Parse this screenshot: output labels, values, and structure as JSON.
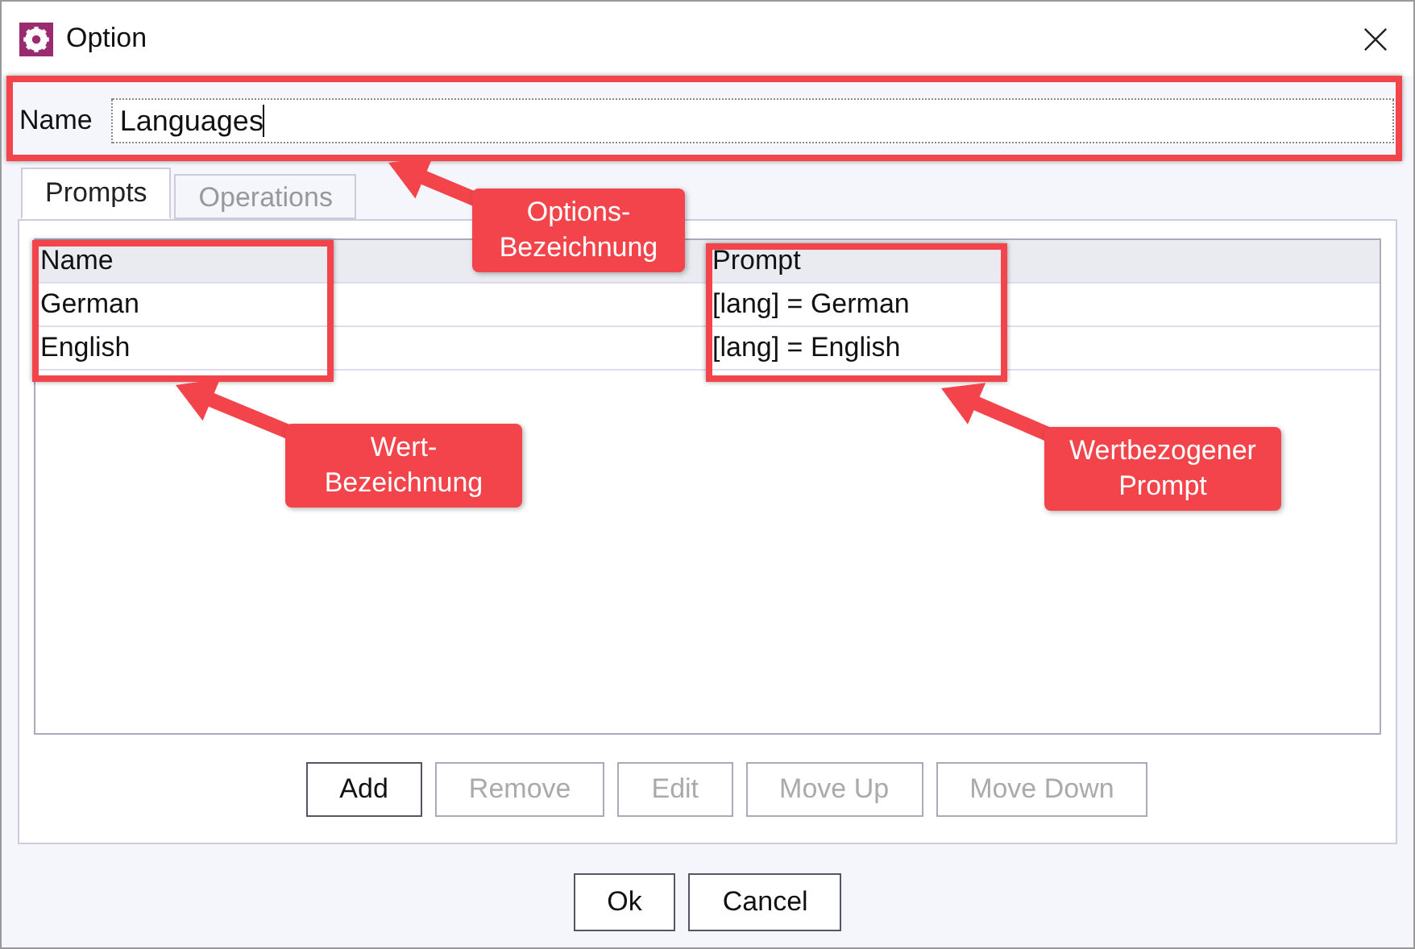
{
  "window": {
    "title": "Option"
  },
  "name_field": {
    "label": "Name",
    "value": "Languages"
  },
  "tabs": [
    {
      "label": "Prompts",
      "selected": true,
      "disabled": false
    },
    {
      "label": "Operations",
      "selected": false,
      "disabled": true
    }
  ],
  "table": {
    "columns": [
      "Name",
      "Prompt"
    ],
    "rows": [
      [
        "German",
        "[lang] = German"
      ],
      [
        "English",
        "[lang] = English"
      ]
    ]
  },
  "list_buttons": [
    {
      "label": "Add",
      "disabled": false
    },
    {
      "label": "Remove",
      "disabled": true
    },
    {
      "label": "Edit",
      "disabled": true
    },
    {
      "label": "Move Up",
      "disabled": true
    },
    {
      "label": "Move Down",
      "disabled": true
    }
  ],
  "dialog_buttons": [
    {
      "label": "Ok",
      "disabled": false
    },
    {
      "label": "Cancel",
      "disabled": false
    }
  ],
  "annotations": [
    {
      "lines": [
        "Options-",
        "Bezeichnung"
      ]
    },
    {
      "lines": [
        "Wert-",
        "Bezeichnung"
      ]
    },
    {
      "lines": [
        "Wertbezogener",
        "Prompt"
      ]
    }
  ]
}
